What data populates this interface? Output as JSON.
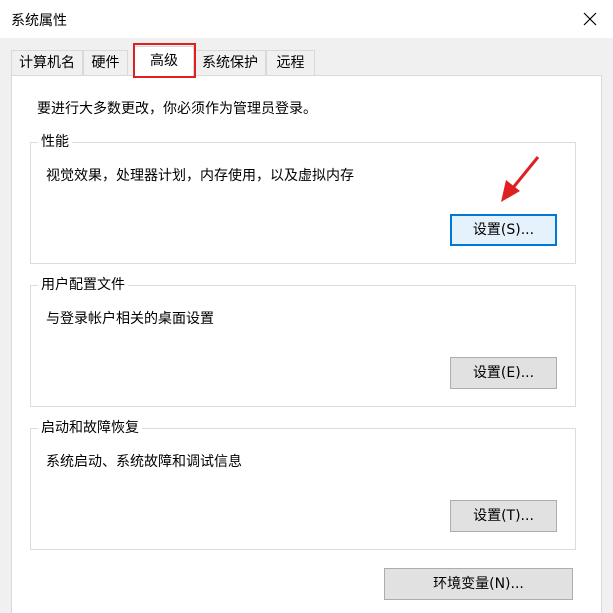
{
  "window": {
    "title": "系统属性"
  },
  "tabs": [
    {
      "label": "计算机名",
      "active": false
    },
    {
      "label": "硬件",
      "active": false
    },
    {
      "label": "高级",
      "active": true
    },
    {
      "label": "系统保护",
      "active": false
    },
    {
      "label": "远程",
      "active": false
    }
  ],
  "notice": "要进行大多数更改，你必须作为管理员登录。",
  "groups": {
    "performance": {
      "title": "性能",
      "description": "视觉效果，处理器计划，内存使用，以及虚拟内存",
      "button": "设置(S)..."
    },
    "user_profiles": {
      "title": "用户配置文件",
      "description": "与登录帐户相关的桌面设置",
      "button": "设置(E)..."
    },
    "startup_recovery": {
      "title": "启动和故障恢复",
      "description": "系统启动、系统故障和调试信息",
      "button": "设置(T)..."
    }
  },
  "env_button": "环境变量(N)...",
  "colors": {
    "highlight": "#e02020",
    "focus": "#0078d7"
  },
  "icons": {
    "close": "close-icon",
    "annotation": "red-arrow-icon"
  }
}
